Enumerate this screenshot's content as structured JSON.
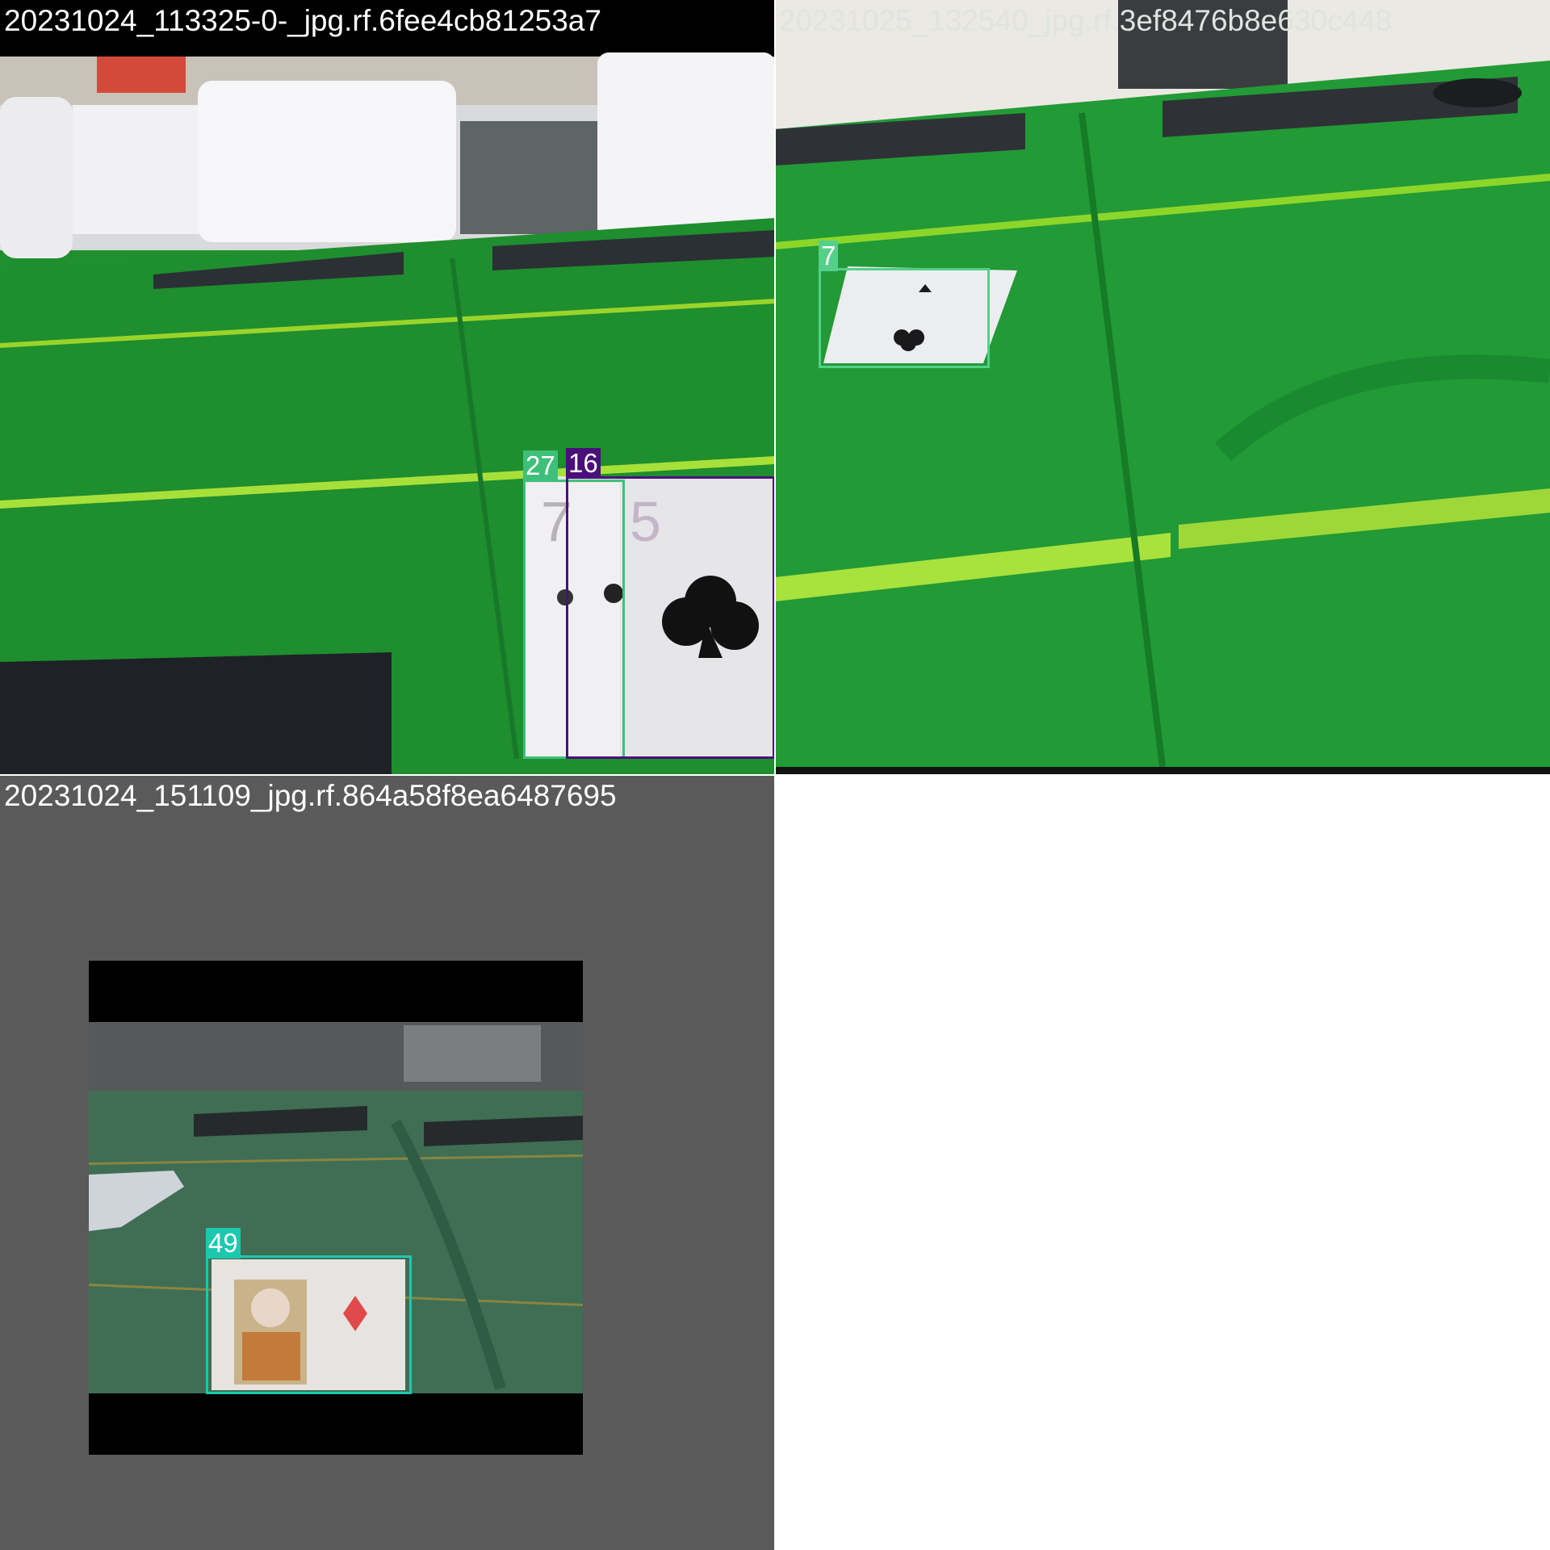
{
  "tiles": [
    {
      "filename": "20231024_113325-0-_jpg.rf.6fee4cb81253a7",
      "title_color": "#ffffff",
      "detections": [
        {
          "label": "27",
          "color": "#3ec07a"
        },
        {
          "label": "16",
          "color": "#4a0f7a"
        }
      ]
    },
    {
      "filename": "20231025_132540_jpg.rf.3ef8476b8e630c448",
      "title_color": "#dfe4e0",
      "detections": [
        {
          "label": "7",
          "color": "#55d08a"
        }
      ]
    },
    {
      "filename": "20231024_151109_jpg.rf.864a58f8ea6487695",
      "title_color": "#ffffff",
      "detections": [
        {
          "label": "49",
          "color": "#1cc8b0"
        }
      ]
    }
  ]
}
